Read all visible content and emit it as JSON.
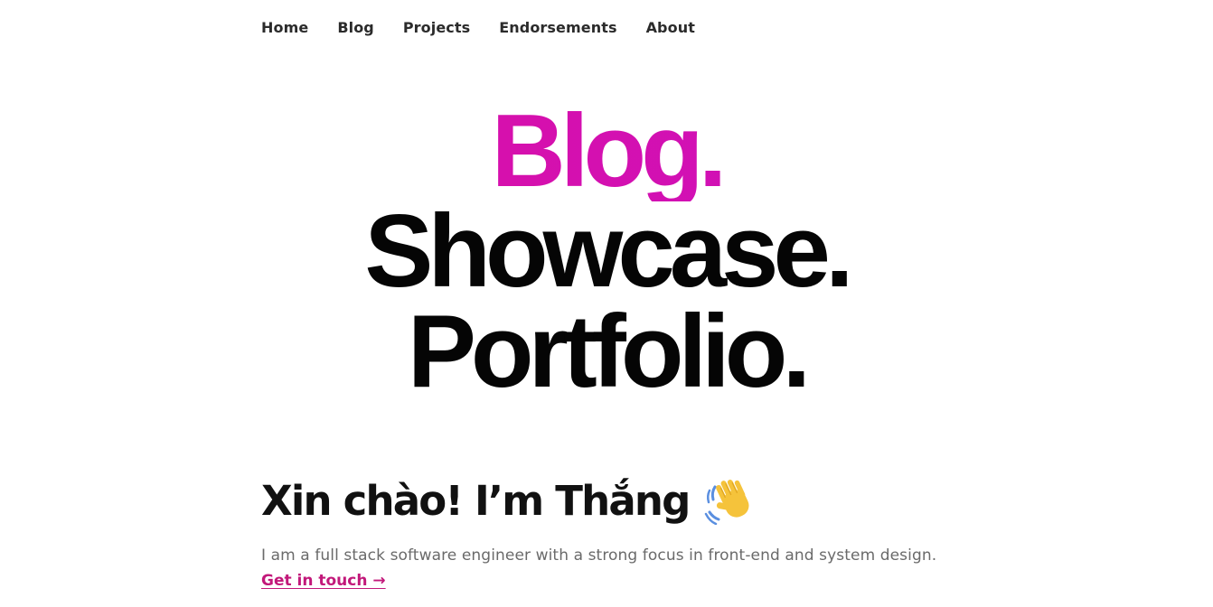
{
  "nav": {
    "items": [
      {
        "label": "Home"
      },
      {
        "label": "Blog"
      },
      {
        "label": "Projects"
      },
      {
        "label": "Endorsements"
      },
      {
        "label": "About"
      }
    ]
  },
  "hero": {
    "line1": "Blog.",
    "line2": "Showcase.",
    "line3": "Portfolio."
  },
  "intro": {
    "greeting": "Xin chào! I’m Thắng",
    "wave_icon": "waving-hand-icon",
    "bio": "I am a full stack software engineer with a strong focus in front-end and system design.",
    "cta": "Get in touch →"
  },
  "colors": {
    "accent_start": "#e0109b",
    "accent_end": "#c711c6",
    "link": "#c2187a",
    "heading": "#050505",
    "muted_text": "#6a6a6a"
  }
}
